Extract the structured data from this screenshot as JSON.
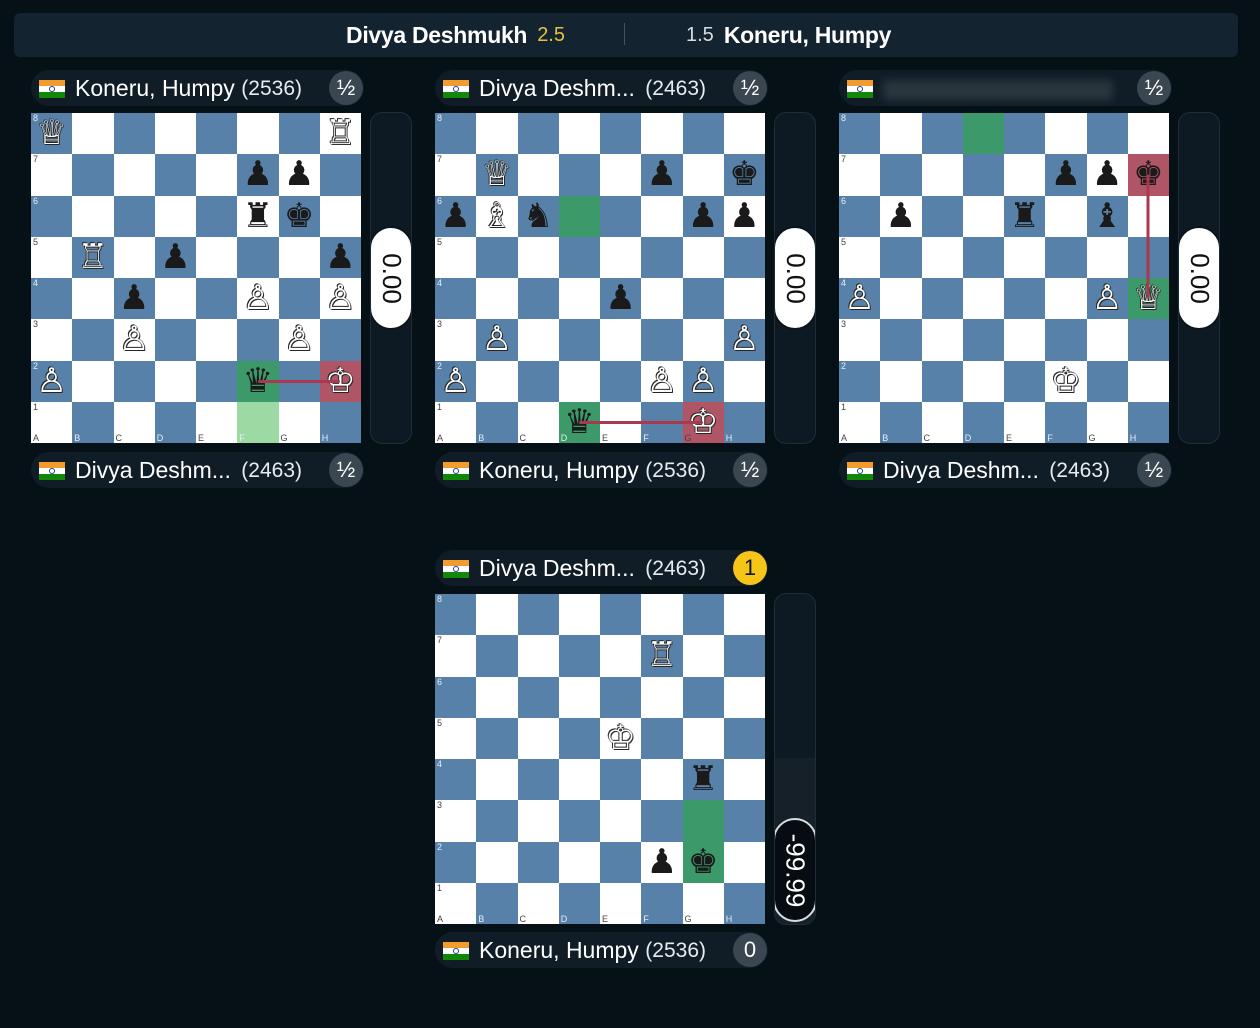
{
  "match": {
    "left_player": "Divya Deshmukh",
    "left_score": "2.5",
    "right_score": "1.5",
    "right_player": "Koneru, Humpy"
  },
  "colors": {
    "light_square": "#ffffff",
    "dark_square": "#5781a8",
    "move_from": "#3c9a6a",
    "check": "#b05566",
    "arrow": "#a8394e",
    "win_badge": "#f5c518"
  },
  "games": [
    {
      "top": {
        "flag": "india-flag",
        "name": "Koneru, Humpy",
        "rating": "(2536)",
        "result": "½"
      },
      "bottom": {
        "flag": "india-flag",
        "name": "Divya Deshm...",
        "rating": "(2463)",
        "result": "½"
      },
      "eval": "0.00",
      "pieces": [
        {
          "sq": "a8",
          "piece": "Q",
          "color": "w"
        },
        {
          "sq": "h8",
          "piece": "R",
          "color": "w"
        },
        {
          "sq": "f7",
          "piece": "P",
          "color": "b"
        },
        {
          "sq": "g7",
          "piece": "P",
          "color": "b"
        },
        {
          "sq": "f6",
          "piece": "R",
          "color": "b"
        },
        {
          "sq": "g6",
          "piece": "K",
          "color": "b"
        },
        {
          "sq": "b5",
          "piece": "R",
          "color": "w"
        },
        {
          "sq": "d5",
          "piece": "P",
          "color": "b"
        },
        {
          "sq": "h5",
          "piece": "P",
          "color": "b"
        },
        {
          "sq": "c4",
          "piece": "P",
          "color": "b"
        },
        {
          "sq": "f4",
          "piece": "P",
          "color": "w"
        },
        {
          "sq": "h4",
          "piece": "P",
          "color": "w"
        },
        {
          "sq": "c3",
          "piece": "P",
          "color": "w"
        },
        {
          "sq": "g3",
          "piece": "P",
          "color": "w"
        },
        {
          "sq": "a2",
          "piece": "P",
          "color": "w"
        },
        {
          "sq": "f2",
          "piece": "Q",
          "color": "b"
        },
        {
          "sq": "h2",
          "piece": "K",
          "color": "w"
        }
      ],
      "highlights": [
        {
          "sq": "f2",
          "type": "green"
        },
        {
          "sq": "f1",
          "type": "lgreen"
        },
        {
          "sq": "h2",
          "type": "red"
        }
      ],
      "arrow": [
        "f2",
        "h2"
      ]
    },
    {
      "top": {
        "flag": "india-flag",
        "name": "Divya Deshm...",
        "rating": "(2463)",
        "result": "½"
      },
      "bottom": {
        "flag": "india-flag",
        "name": "Koneru, Humpy",
        "rating": "(2536)",
        "result": "½"
      },
      "eval": "0.00",
      "pieces": [
        {
          "sq": "b7",
          "piece": "Q",
          "color": "w"
        },
        {
          "sq": "f7",
          "piece": "P",
          "color": "b"
        },
        {
          "sq": "h7",
          "piece": "K",
          "color": "b"
        },
        {
          "sq": "a6",
          "piece": "P",
          "color": "b"
        },
        {
          "sq": "b6",
          "piece": "B",
          "color": "w"
        },
        {
          "sq": "c6",
          "piece": "N",
          "color": "b"
        },
        {
          "sq": "g6",
          "piece": "P",
          "color": "b"
        },
        {
          "sq": "h6",
          "piece": "P",
          "color": "b"
        },
        {
          "sq": "e4",
          "piece": "P",
          "color": "b"
        },
        {
          "sq": "b3",
          "piece": "P",
          "color": "w"
        },
        {
          "sq": "h3",
          "piece": "P",
          "color": "w"
        },
        {
          "sq": "a2",
          "piece": "P",
          "color": "w"
        },
        {
          "sq": "f2",
          "piece": "P",
          "color": "w"
        },
        {
          "sq": "g2",
          "piece": "P",
          "color": "w"
        },
        {
          "sq": "d1",
          "piece": "Q",
          "color": "b"
        },
        {
          "sq": "g1",
          "piece": "K",
          "color": "w"
        }
      ],
      "highlights": [
        {
          "sq": "d6",
          "type": "green"
        },
        {
          "sq": "d1",
          "type": "green"
        },
        {
          "sq": "g1",
          "type": "red"
        }
      ],
      "arrow": [
        "d1",
        "g1"
      ]
    },
    {
      "top": {
        "flag": "india-flag",
        "name": "",
        "rating": "",
        "result": "½"
      },
      "bottom": {
        "flag": "india-flag",
        "name": "Divya Deshm...",
        "rating": "(2463)",
        "result": "½"
      },
      "eval": "0.00",
      "pieces": [
        {
          "sq": "f7",
          "piece": "P",
          "color": "b"
        },
        {
          "sq": "g7",
          "piece": "P",
          "color": "b"
        },
        {
          "sq": "h7",
          "piece": "K",
          "color": "b"
        },
        {
          "sq": "b6",
          "piece": "P",
          "color": "b"
        },
        {
          "sq": "e6",
          "piece": "R",
          "color": "b"
        },
        {
          "sq": "g6",
          "piece": "B",
          "color": "b"
        },
        {
          "sq": "a4",
          "piece": "P",
          "color": "w"
        },
        {
          "sq": "g4",
          "piece": "P",
          "color": "w"
        },
        {
          "sq": "h4",
          "piece": "Q",
          "color": "w"
        },
        {
          "sq": "f2",
          "piece": "K",
          "color": "w"
        }
      ],
      "highlights": [
        {
          "sq": "d8",
          "type": "green"
        },
        {
          "sq": "h4",
          "type": "green"
        },
        {
          "sq": "h7",
          "type": "red"
        }
      ],
      "arrow": [
        "h4",
        "h7"
      ]
    },
    {
      "top": {
        "flag": "india-flag",
        "name": "Divya Deshm...",
        "rating": "(2463)",
        "result": "1"
      },
      "bottom": {
        "flag": "india-flag",
        "name": "Koneru, Humpy",
        "rating": "(2536)",
        "result": "0"
      },
      "eval": "-99.99",
      "eval_black_fraction": 0.5,
      "pieces": [
        {
          "sq": "f7",
          "piece": "R",
          "color": "w"
        },
        {
          "sq": "e5",
          "piece": "K",
          "color": "w"
        },
        {
          "sq": "g4",
          "piece": "R",
          "color": "b"
        },
        {
          "sq": "f2",
          "piece": "P",
          "color": "b"
        },
        {
          "sq": "g2",
          "piece": "K",
          "color": "b"
        }
      ],
      "highlights": [
        {
          "sq": "g3",
          "type": "green"
        },
        {
          "sq": "g2",
          "type": "green"
        }
      ],
      "arrow": null
    }
  ]
}
